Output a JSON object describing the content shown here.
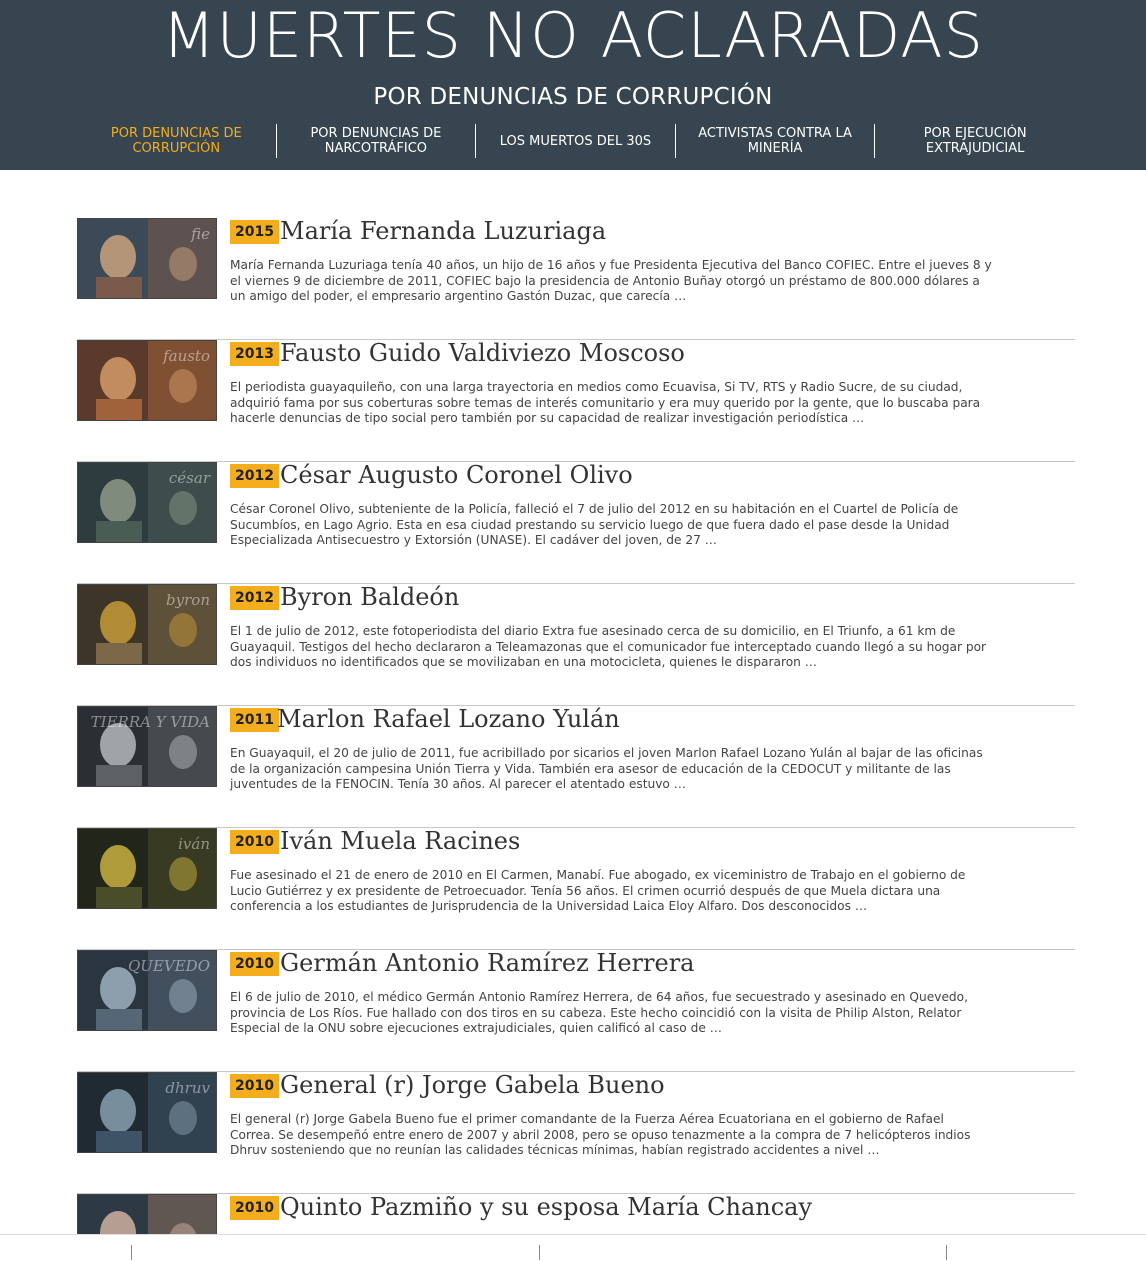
{
  "header": {
    "title": "MUERTES NO ACLARADAS",
    "subtitle": "POR DENUNCIAS DE CORRUPCIÓN",
    "nav": [
      {
        "label": "POR DENUNCIAS DE CORRUPCIÓN",
        "active": true
      },
      {
        "label": "POR DENUNCIAS DE NARCOTRÁFICO",
        "active": false
      },
      {
        "label": "LOS MUERTOS DEL 30S",
        "active": false
      },
      {
        "label": "ACTIVISTAS CONTRA LA MINERÍA",
        "active": false
      },
      {
        "label": "POR EJECUCIÓN EXTRAJUDICIAL",
        "active": false
      }
    ]
  },
  "colors": {
    "header_bg": "#36454f",
    "accent": "#f4ad1d",
    "text": "#333333"
  },
  "entries": [
    {
      "year": "2015",
      "name": "María Fernanda Luzuriaga",
      "excerpt": "María Fernanda Luzuriaga tenía 40 años, un hijo de 16 años y fue Presidenta Ejecutiva del Banco COFIEC. Entre el jueves 8 y el viernes 9 de diciembre de 2011, COFIEC bajo la presidencia de Antonio Buñay otorgó un préstamo de 800.000 dólares a un amigo del poder, el empresario argentino Gastón Duzac, que carecía …",
      "thumb_word": "fie"
    },
    {
      "year": "2013",
      "name": "Fausto Guido Valdiviezo Moscoso",
      "excerpt": "El periodista guayaquileño, con una larga trayectoria en medios como Ecuavisa, Si TV, RTS y Radio Sucre, de su ciudad, adquirió fama por sus coberturas sobre temas de interés comunitario y era muy querido por la gente, que lo buscaba para hacerle denuncias de tipo social pero también por su capacidad de realizar investigación periodística …",
      "thumb_word": "fausto"
    },
    {
      "year": "2012",
      "name": "César Augusto Coronel Olivo",
      "excerpt": "César Coronel Olivo, subteniente de la Policía, falleció el 7 de julio del 2012 en su habitación en el Cuartel de Policía de Sucumbíos, en Lago Agrio. Esta en esa ciudad  prestando su servicio luego de que fuera dado el pase desde la Unidad Especializada Antisecuestro y Extorsión (UNASE). El cadáver del joven, de 27 …",
      "thumb_word": "césar"
    },
    {
      "year": "2012",
      "name": "Byron Baldeón",
      "excerpt": "El 1 de julio de 2012, este fotoperiodista del diario Extra fue asesinado cerca de su domicilio, en El Triunfo, a 61 km de Guayaquil. Testigos del hecho declararon a Teleamazonas que el comunicador fue interceptado cuando llegó a su hogar por dos individuos no identificados que se movilizaban en una motocicleta, quienes le dispararon …",
      "thumb_word": "byron"
    },
    {
      "year": "2011",
      "name": "Marlon Rafael Lozano Yulán",
      "excerpt": "En Guayaquil, el 20 de julio de 2011, fue acribillado por sicarios el joven Marlon Rafael Lozano Yulán al bajar de las oficinas de la organización campesina Unión Tierra y Vida. También era asesor de educación de la CEDOCUT y militante de las juventudes de la FENOCIN. Tenía 30 años. Al parecer el atentado estuvo …",
      "thumb_word": "TIERRA Y VIDA"
    },
    {
      "year": "2010",
      "name": "Iván Muela Racines",
      "excerpt": "Fue asesinado el 21 de enero de 2010 en El Carmen, Manabí. Fue abogado, ex viceministro de Trabajo en el gobierno de Lucio Gutiérrez y ex presidente de Petroecuador. Tenía 56 años. El crimen ocurrió después de que Muela dictara una conferencia a los estudiantes de Jurisprudencia de la Universidad Laica Eloy Alfaro. Dos desconocidos …",
      "thumb_word": "iván"
    },
    {
      "year": "2010",
      "name": "Germán Antonio Ramírez Herrera",
      "excerpt": "El 6 de julio de 2010, el médico Germán Antonio Ramírez Herrera, de 64 años, fue secuestrado y asesinado en Quevedo, provincia de Los Ríos. Fue hallado con dos tiros en su cabeza. Este hecho coincidió con la visita de Philip Alston, Relator Especial de la ONU sobre ejecuciones extrajudiciales, quien calificó al caso de …",
      "thumb_word": "QUEVEDO"
    },
    {
      "year": "2010",
      "name": "General (r) Jorge Gabela Bueno",
      "excerpt": "El general (r) Jorge Gabela Bueno fue el primer comandante de la Fuerza Aérea Ecuatoriana en el gobierno de Rafael Correa. Se desempeñó entre enero de 2007 y abril 2008, pero se opuso tenazmente a la compra de 7 helicópteros indios Dhruv sosteniendo que no reunían las calidades técnicas mínimas, habían registrado accidentes a nivel …",
      "thumb_word": "dhruv"
    },
    {
      "year": "2010",
      "name": "Quinto Pazmiño y su esposa María Chancay",
      "excerpt": "",
      "thumb_word": ""
    }
  ]
}
